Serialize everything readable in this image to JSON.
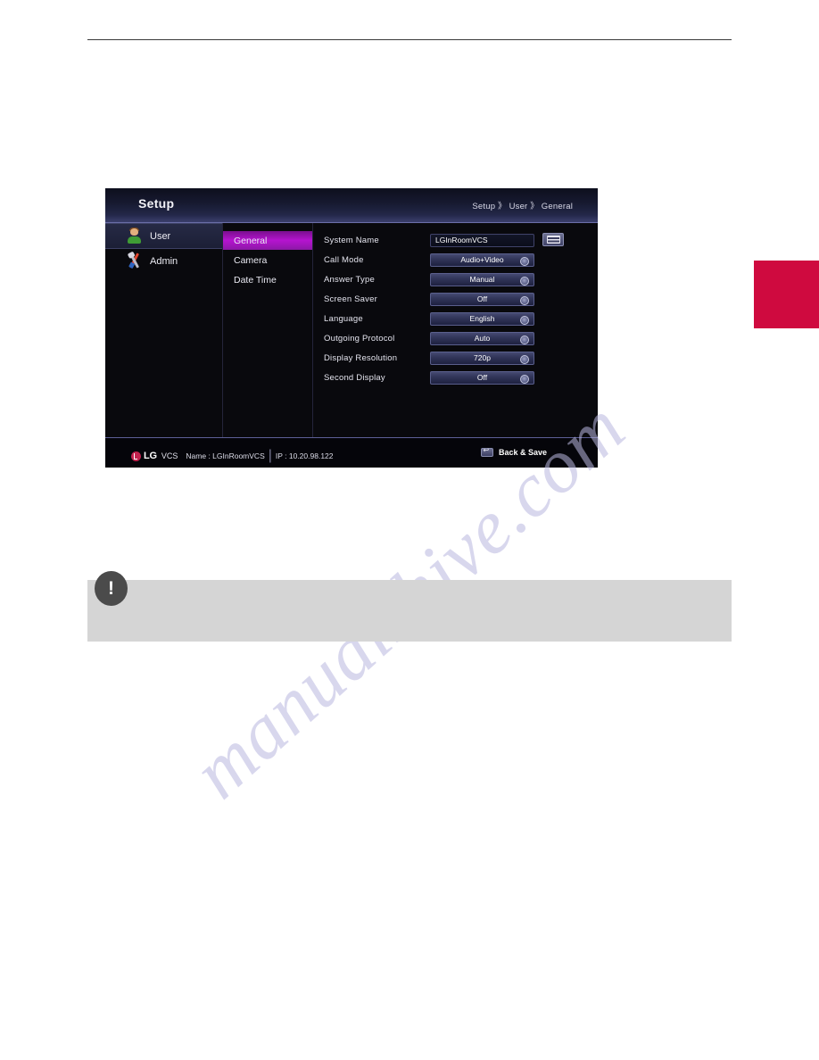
{
  "document": {
    "note_box": {
      "icon": "exclamation-icon"
    },
    "watermark": "manualshive.com"
  },
  "osd": {
    "header": {
      "title": "Setup",
      "breadcrumb": "Setup 》 User 》 General"
    },
    "categories": [
      {
        "label": "User",
        "icon": "user-avatar-icon",
        "active": true
      },
      {
        "label": "Admin",
        "icon": "tools-icon",
        "active": false
      }
    ],
    "menu": [
      {
        "label": "General",
        "active": true
      },
      {
        "label": "Camera",
        "active": false
      },
      {
        "label": "Date Time",
        "active": false
      }
    ],
    "settings": [
      {
        "label": "System Name",
        "value": "LGInRoomVCS",
        "type": "text",
        "has_keyboard": true
      },
      {
        "label": "Call Mode",
        "value": "Audio+Video",
        "type": "selector"
      },
      {
        "label": "Answer Type",
        "value": "Manual",
        "type": "selector"
      },
      {
        "label": "Screen Saver",
        "value": "Off",
        "type": "selector"
      },
      {
        "label": "Language",
        "value": "English",
        "type": "selector"
      },
      {
        "label": "Outgoing Protocol",
        "value": "Auto",
        "type": "selector"
      },
      {
        "label": "Display Resolution",
        "value": "720p",
        "type": "selector"
      },
      {
        "label": "Second Display",
        "value": "Off",
        "type": "selector"
      }
    ],
    "footer": {
      "brand": "LG",
      "product": "VCS",
      "name_label": "Name : LGInRoomVCS",
      "ip_label": "IP : 10.20.98.122",
      "back_save_label": "Back & Save"
    }
  },
  "colors": {
    "accent_magenta": "#b514cf",
    "side_tab_red": "#cf0a3f",
    "lg_red": "#c4234f",
    "note_gray": "#d5d5d5"
  }
}
